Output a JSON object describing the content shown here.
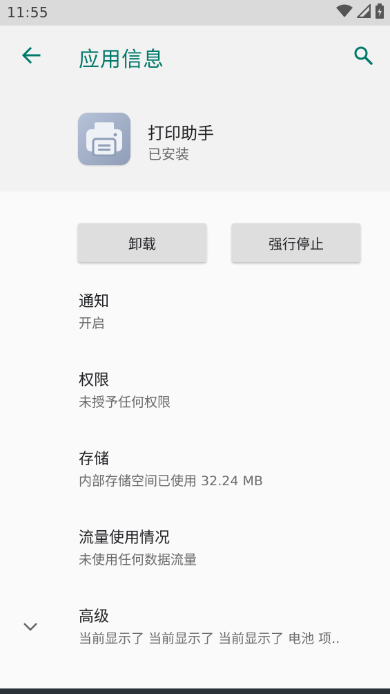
{
  "status_bar": {
    "time": "11:55"
  },
  "app_bar": {
    "title": "应用信息"
  },
  "app": {
    "name": "打印助手",
    "status": "已安装"
  },
  "buttons": {
    "uninstall": "卸载",
    "force_stop": "强行停止"
  },
  "prefs": [
    {
      "title": "通知",
      "summary": "开启"
    },
    {
      "title": "权限",
      "summary": "未授予任何权限"
    },
    {
      "title": "存储",
      "summary": "内部存储空间已使用 32.24 MB"
    },
    {
      "title": "流量使用情况",
      "summary": "未使用任何数据流量"
    },
    {
      "title": "高级",
      "summary": "当前显示了 当前显示了 当前显示了 电池 项.."
    }
  ],
  "colors": {
    "accent": "#00796b",
    "background": "#fafafa",
    "header": "#f2f2f2"
  }
}
